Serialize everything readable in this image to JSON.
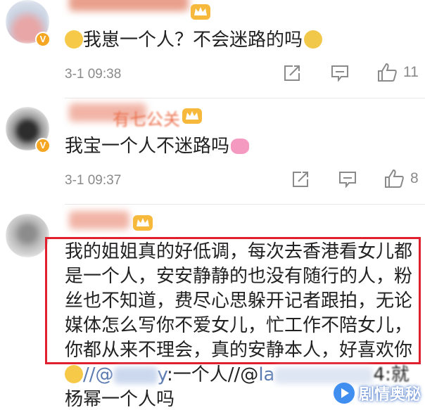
{
  "comments": [
    {
      "text": "我崽一个人？不会迷路的吗",
      "time": "3-1 09:38",
      "likes": "11"
    },
    {
      "name_fragment": "有七公关",
      "text": "我宝一个人不迷路吗",
      "time": "3-1 09:37",
      "likes": "8"
    },
    {
      "text_lines": [
        "我的姐姐真的好低调，每次去香港看女儿都",
        "是一个人，安安静静的也没有随行的人，粉",
        "丝也不知道，费尽心思躲开记者跟拍，无论",
        "媒体怎么写你不爱女儿，忙工作不陪女儿，",
        "你都从来不理会，真的安静本人，好喜欢你"
      ],
      "reply_prefix": "//@",
      "reply_user_end": "y",
      "reply_sep": ":一个人//@",
      "reply_user2_start": "la",
      "reply_tail": "4:就",
      "reply_line2": "杨幂一个人吗"
    }
  ],
  "watermark": "剧情奥秘",
  "colors": {
    "name": "#eb7350",
    "vip_badge": "#f5a623",
    "highlight": "#e0202e",
    "mention": "#5b7bb1",
    "meta": "#8a8a8a"
  },
  "icons": [
    "crown-icon",
    "verified-badge-icon",
    "share-icon",
    "comment-icon",
    "like-icon",
    "emoji-icon"
  ]
}
